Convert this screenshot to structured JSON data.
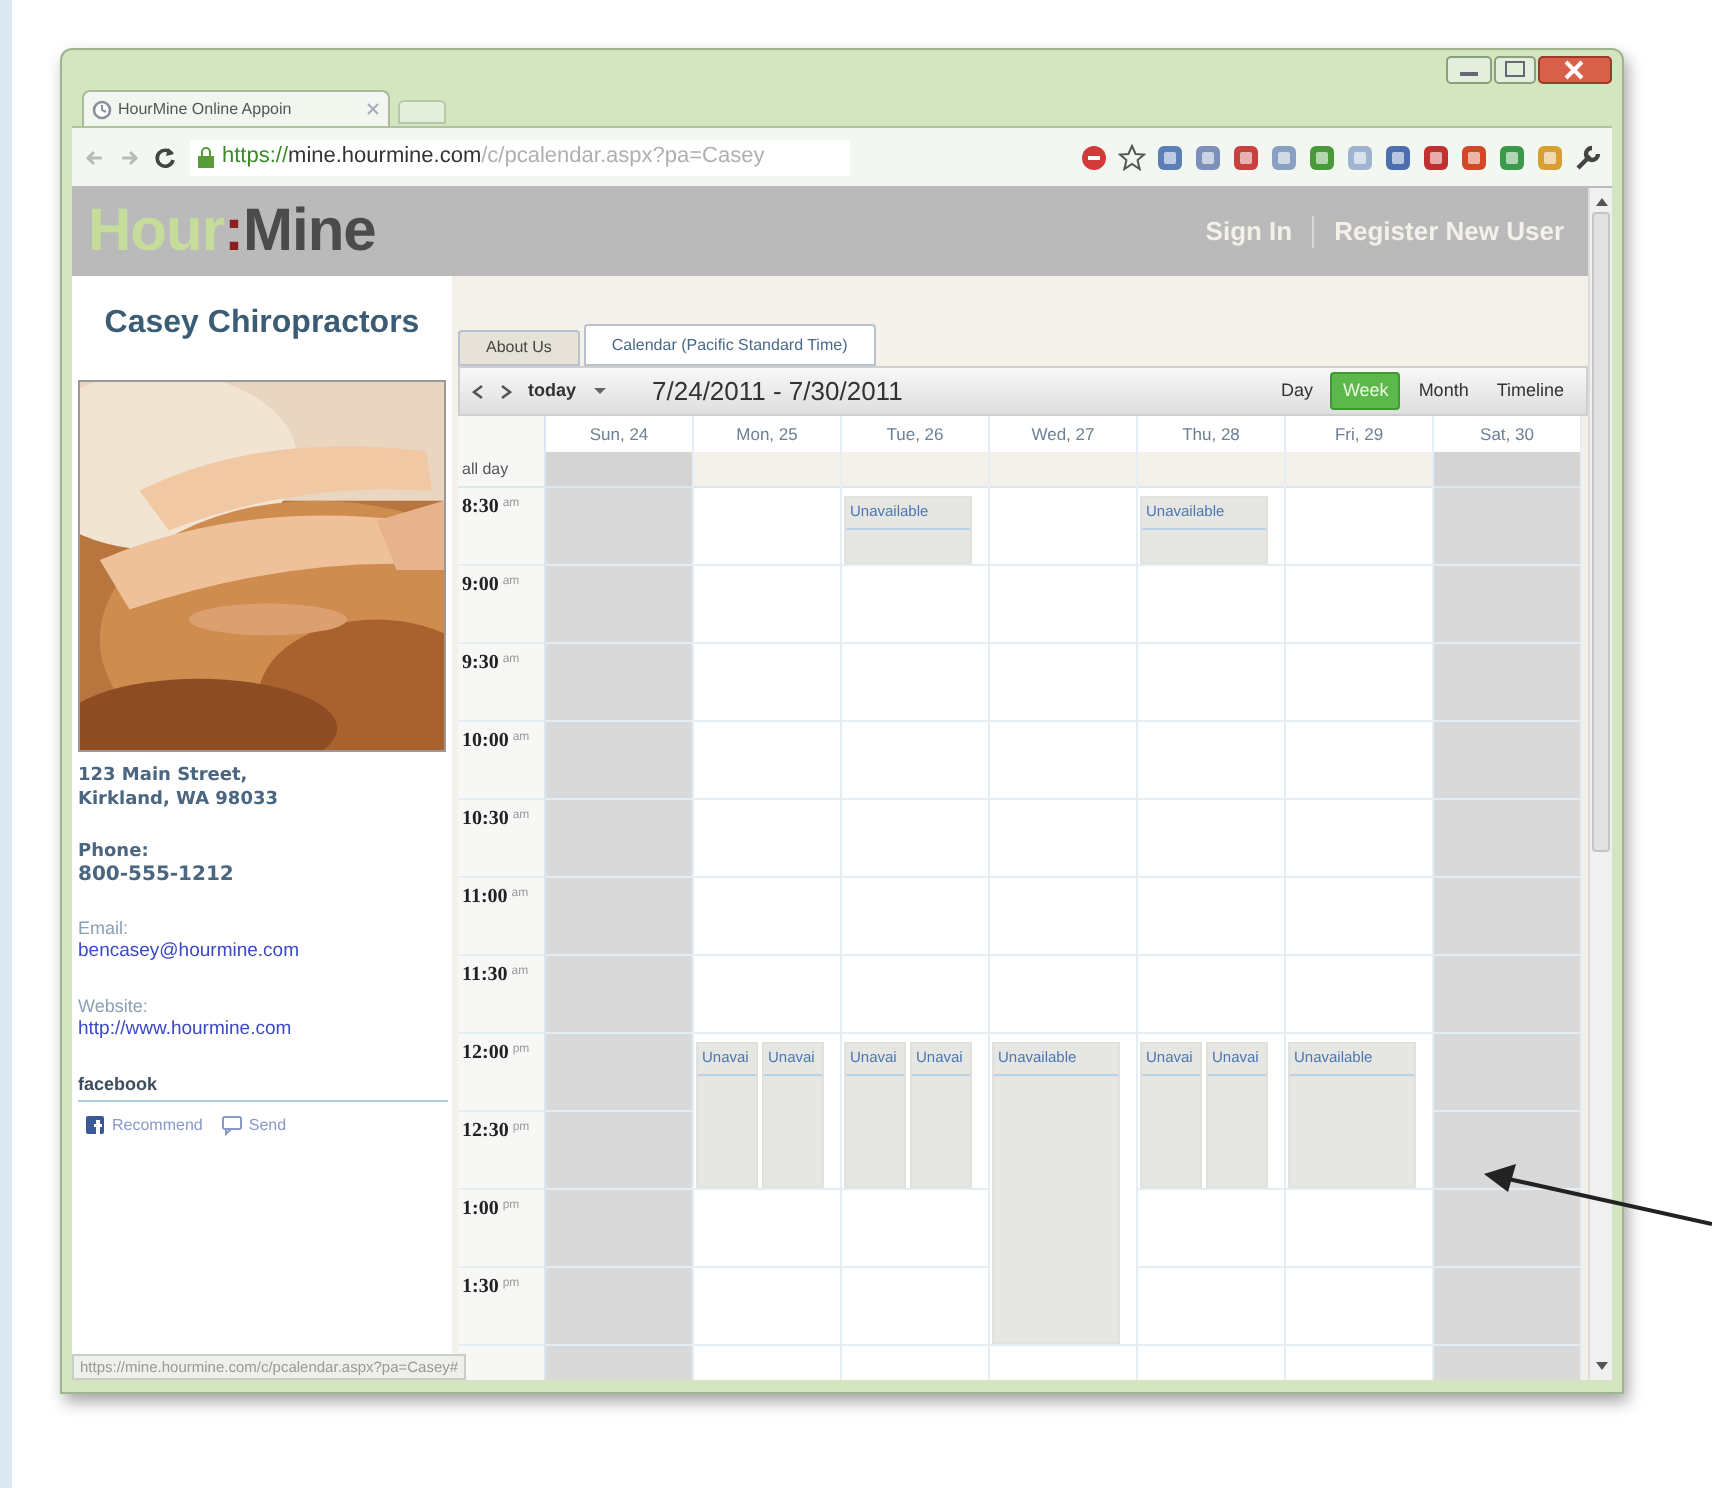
{
  "browser": {
    "tab_title": "HourMine Online Appoin",
    "url_scheme": "https://",
    "url_host": "mine.hourmine.com",
    "url_path": "/c/pcalendar.aspx?pa=Casey",
    "status_url": "https://mine.hourmine.com/c/pcalendar.aspx?pa=Casey#"
  },
  "site": {
    "logo": [
      {
        "text": "Hour",
        "color": "#c5dc9a"
      },
      {
        "text": ":",
        "color": "#8a1f1f"
      },
      {
        "text": "Mine",
        "color": "#4b4b4b"
      }
    ],
    "nav": [
      "Sign In",
      "Register New User"
    ]
  },
  "business": {
    "name": "Casey Chiropractors",
    "address": [
      "123 Main Street,",
      "Kirkland, WA 98033"
    ],
    "phone_label": "Phone:",
    "phone": "800-555-1212",
    "email_label": "Email:",
    "email": "bencasey@hourmine.com",
    "website_label": "Website:",
    "website": "http://www.hourmine.com",
    "social_title": "facebook",
    "social_buttons": [
      {
        "kind": "recommend",
        "label": "Recommend"
      },
      {
        "kind": "send",
        "label": "Send"
      }
    ]
  },
  "tabs": [
    {
      "label": "About Us",
      "selected": false
    },
    {
      "label": "Calendar (Pacific Standard Time)",
      "selected": true
    }
  ],
  "toolbar": {
    "today": "today",
    "range": "7/24/2011 - 7/30/2011",
    "views": [
      {
        "label": "Day",
        "selected": false
      },
      {
        "label": "Week",
        "selected": true
      },
      {
        "label": "Month",
        "selected": false
      },
      {
        "label": "Timeline",
        "selected": false
      }
    ]
  },
  "calendar": {
    "all_day_label": "all day",
    "times": [
      {
        "time": "8:30",
        "meridiem": "am"
      },
      {
        "time": "9:00",
        "meridiem": "am"
      },
      {
        "time": "9:30",
        "meridiem": "am"
      },
      {
        "time": "10:00",
        "meridiem": "am"
      },
      {
        "time": "10:30",
        "meridiem": "am"
      },
      {
        "time": "11:00",
        "meridiem": "am"
      },
      {
        "time": "11:30",
        "meridiem": "am"
      },
      {
        "time": "12:00",
        "meridiem": "pm"
      },
      {
        "time": "12:30",
        "meridiem": "pm"
      },
      {
        "time": "1:00",
        "meridiem": "pm"
      },
      {
        "time": "1:30",
        "meridiem": "pm"
      }
    ],
    "days": [
      {
        "label": "Sun, 24",
        "shaded": true,
        "slots": [
          {
            "busy": false
          },
          {
            "busy": false
          },
          {
            "busy": false
          },
          {
            "busy": false
          },
          {
            "busy": false
          },
          {
            "busy": false
          },
          {
            "busy": false
          },
          {
            "busy": false
          },
          {
            "busy": false
          },
          {
            "busy": false
          },
          {
            "busy": false
          }
        ]
      },
      {
        "label": "Mon, 25",
        "shaded": false,
        "slots": [
          {
            "busy": false
          },
          {
            "busy": false
          },
          {
            "busy": false
          },
          {
            "busy": false
          },
          {
            "busy": false
          },
          {
            "busy": false
          },
          {
            "busy": false
          },
          {
            "busy": true,
            "labels": [
              "Unavai",
              "Unavai"
            ]
          },
          {
            "busy": true
          },
          {
            "busy": false
          },
          {
            "busy": false
          }
        ]
      },
      {
        "label": "Tue, 26",
        "shaded": false,
        "slots": [
          {
            "busy": true,
            "labels": [
              "Unavailable"
            ]
          },
          {
            "busy": false
          },
          {
            "busy": false
          },
          {
            "busy": false
          },
          {
            "busy": false
          },
          {
            "busy": false
          },
          {
            "busy": false
          },
          {
            "busy": true,
            "labels": [
              "Unavai",
              "Unavai"
            ]
          },
          {
            "busy": true
          },
          {
            "busy": false
          },
          {
            "busy": false
          }
        ]
      },
      {
        "label": "Wed, 27",
        "shaded": false,
        "slots": [
          {
            "busy": false
          },
          {
            "busy": false
          },
          {
            "busy": false
          },
          {
            "busy": false
          },
          {
            "busy": false
          },
          {
            "busy": false
          },
          {
            "busy": false
          },
          {
            "busy": true,
            "labels": [
              "Unavailable"
            ]
          },
          {
            "busy": true
          },
          {
            "busy": true
          },
          {
            "busy": true
          }
        ]
      },
      {
        "label": "Thu, 28",
        "shaded": false,
        "slots": [
          {
            "busy": true,
            "labels": [
              "Unavailable"
            ]
          },
          {
            "busy": false
          },
          {
            "busy": false
          },
          {
            "busy": false
          },
          {
            "busy": false
          },
          {
            "busy": false
          },
          {
            "busy": false
          },
          {
            "busy": true,
            "labels": [
              "Unavai",
              "Unavai"
            ]
          },
          {
            "busy": true
          },
          {
            "busy": false
          },
          {
            "busy": false
          }
        ]
      },
      {
        "label": "Fri, 29",
        "shaded": false,
        "slots": [
          {
            "busy": false
          },
          {
            "busy": false
          },
          {
            "busy": false
          },
          {
            "busy": false
          },
          {
            "busy": false
          },
          {
            "busy": false
          },
          {
            "busy": false
          },
          {
            "busy": true,
            "labels": [
              "Unavailable"
            ]
          },
          {
            "busy": true
          },
          {
            "busy": false
          },
          {
            "busy": false
          }
        ]
      },
      {
        "label": "Sat, 30",
        "shaded": true,
        "slots": [
          {
            "busy": false
          },
          {
            "busy": false
          },
          {
            "busy": false
          },
          {
            "busy": false
          },
          {
            "busy": false
          },
          {
            "busy": false
          },
          {
            "busy": false
          },
          {
            "busy": false
          },
          {
            "busy": false
          },
          {
            "busy": false
          },
          {
            "busy": false
          }
        ]
      }
    ]
  }
}
